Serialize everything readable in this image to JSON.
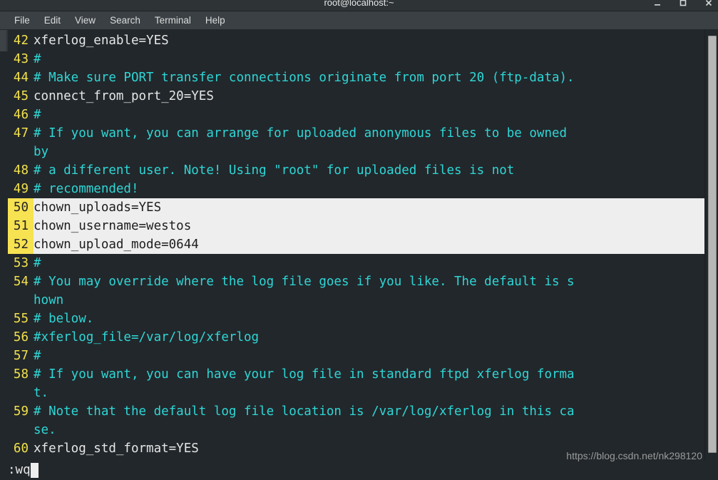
{
  "window": {
    "title": "root@localhost:~",
    "controls": [
      {
        "name": "minimize-button",
        "label": "–"
      },
      {
        "name": "maximize-button",
        "label": "☐"
      },
      {
        "name": "close-button",
        "label": "✕"
      }
    ]
  },
  "menubar": {
    "items": [
      {
        "label": "File"
      },
      {
        "label": "Edit"
      },
      {
        "label": "View"
      },
      {
        "label": "Search"
      },
      {
        "label": "Terminal"
      },
      {
        "label": "Help"
      }
    ]
  },
  "editor": {
    "colors": {
      "background": "#22272b",
      "line_number": "#f2e14c",
      "comment": "#2fd6d6",
      "code": "#e6e6e6",
      "selection_gutter": "#f7e251",
      "selection_background": "#eeeeee",
      "selection_text": "#1d1d1d"
    },
    "rows": [
      {
        "num": "42",
        "text": "xferlog_enable=YES",
        "kind": "code",
        "selected": false,
        "cont": false
      },
      {
        "num": "43",
        "text": "#",
        "kind": "comment",
        "selected": false,
        "cont": false
      },
      {
        "num": "44",
        "text": "# Make sure PORT transfer connections originate from port 20 (ftp-data).",
        "kind": "comment",
        "selected": false,
        "cont": false
      },
      {
        "num": "45",
        "text": "connect_from_port_20=YES",
        "kind": "code",
        "selected": false,
        "cont": false
      },
      {
        "num": "46",
        "text": "#",
        "kind": "comment",
        "selected": false,
        "cont": false
      },
      {
        "num": "47",
        "text": "# If you want, you can arrange for uploaded anonymous files to be owned",
        "kind": "comment",
        "selected": false,
        "cont": false
      },
      {
        "num": "",
        "text": "by",
        "kind": "comment",
        "selected": false,
        "cont": true
      },
      {
        "num": "48",
        "text": "# a different user. Note! Using \"root\" for uploaded files is not",
        "kind": "comment",
        "selected": false,
        "cont": false
      },
      {
        "num": "49",
        "text": "# recommended!",
        "kind": "comment",
        "selected": false,
        "cont": false
      },
      {
        "num": "50",
        "text": "chown_uploads=YES",
        "kind": "code",
        "selected": true,
        "cont": false
      },
      {
        "num": "51",
        "text": "chown_username=westos",
        "kind": "code",
        "selected": true,
        "cont": false
      },
      {
        "num": "52",
        "text": "chown_upload_mode=0644",
        "kind": "code",
        "selected": true,
        "cont": false
      },
      {
        "num": "53",
        "text": "#",
        "kind": "comment",
        "selected": false,
        "cont": false
      },
      {
        "num": "54",
        "text": "# You may override where the log file goes if you like. The default is s",
        "kind": "comment",
        "selected": false,
        "cont": false
      },
      {
        "num": "",
        "text": "hown",
        "kind": "comment",
        "selected": false,
        "cont": true
      },
      {
        "num": "55",
        "text": "# below.",
        "kind": "comment",
        "selected": false,
        "cont": false
      },
      {
        "num": "56",
        "text": "#xferlog_file=/var/log/xferlog",
        "kind": "comment",
        "selected": false,
        "cont": false
      },
      {
        "num": "57",
        "text": "#",
        "kind": "comment",
        "selected": false,
        "cont": false
      },
      {
        "num": "58",
        "text": "# If you want, you can have your log file in standard ftpd xferlog forma",
        "kind": "comment",
        "selected": false,
        "cont": false
      },
      {
        "num": "",
        "text": "t.",
        "kind": "comment",
        "selected": false,
        "cont": true
      },
      {
        "num": "59",
        "text": "# Note that the default log file location is /var/log/xferlog in this ca",
        "kind": "comment",
        "selected": false,
        "cont": false
      },
      {
        "num": "",
        "text": "se.",
        "kind": "comment",
        "selected": false,
        "cont": true
      },
      {
        "num": "60",
        "text": "xferlog_std_format=YES",
        "kind": "code",
        "selected": false,
        "cont": false
      }
    ]
  },
  "commandline": {
    "text": ":wq"
  },
  "watermark": {
    "text": "https://blog.csdn.net/nk298120"
  }
}
